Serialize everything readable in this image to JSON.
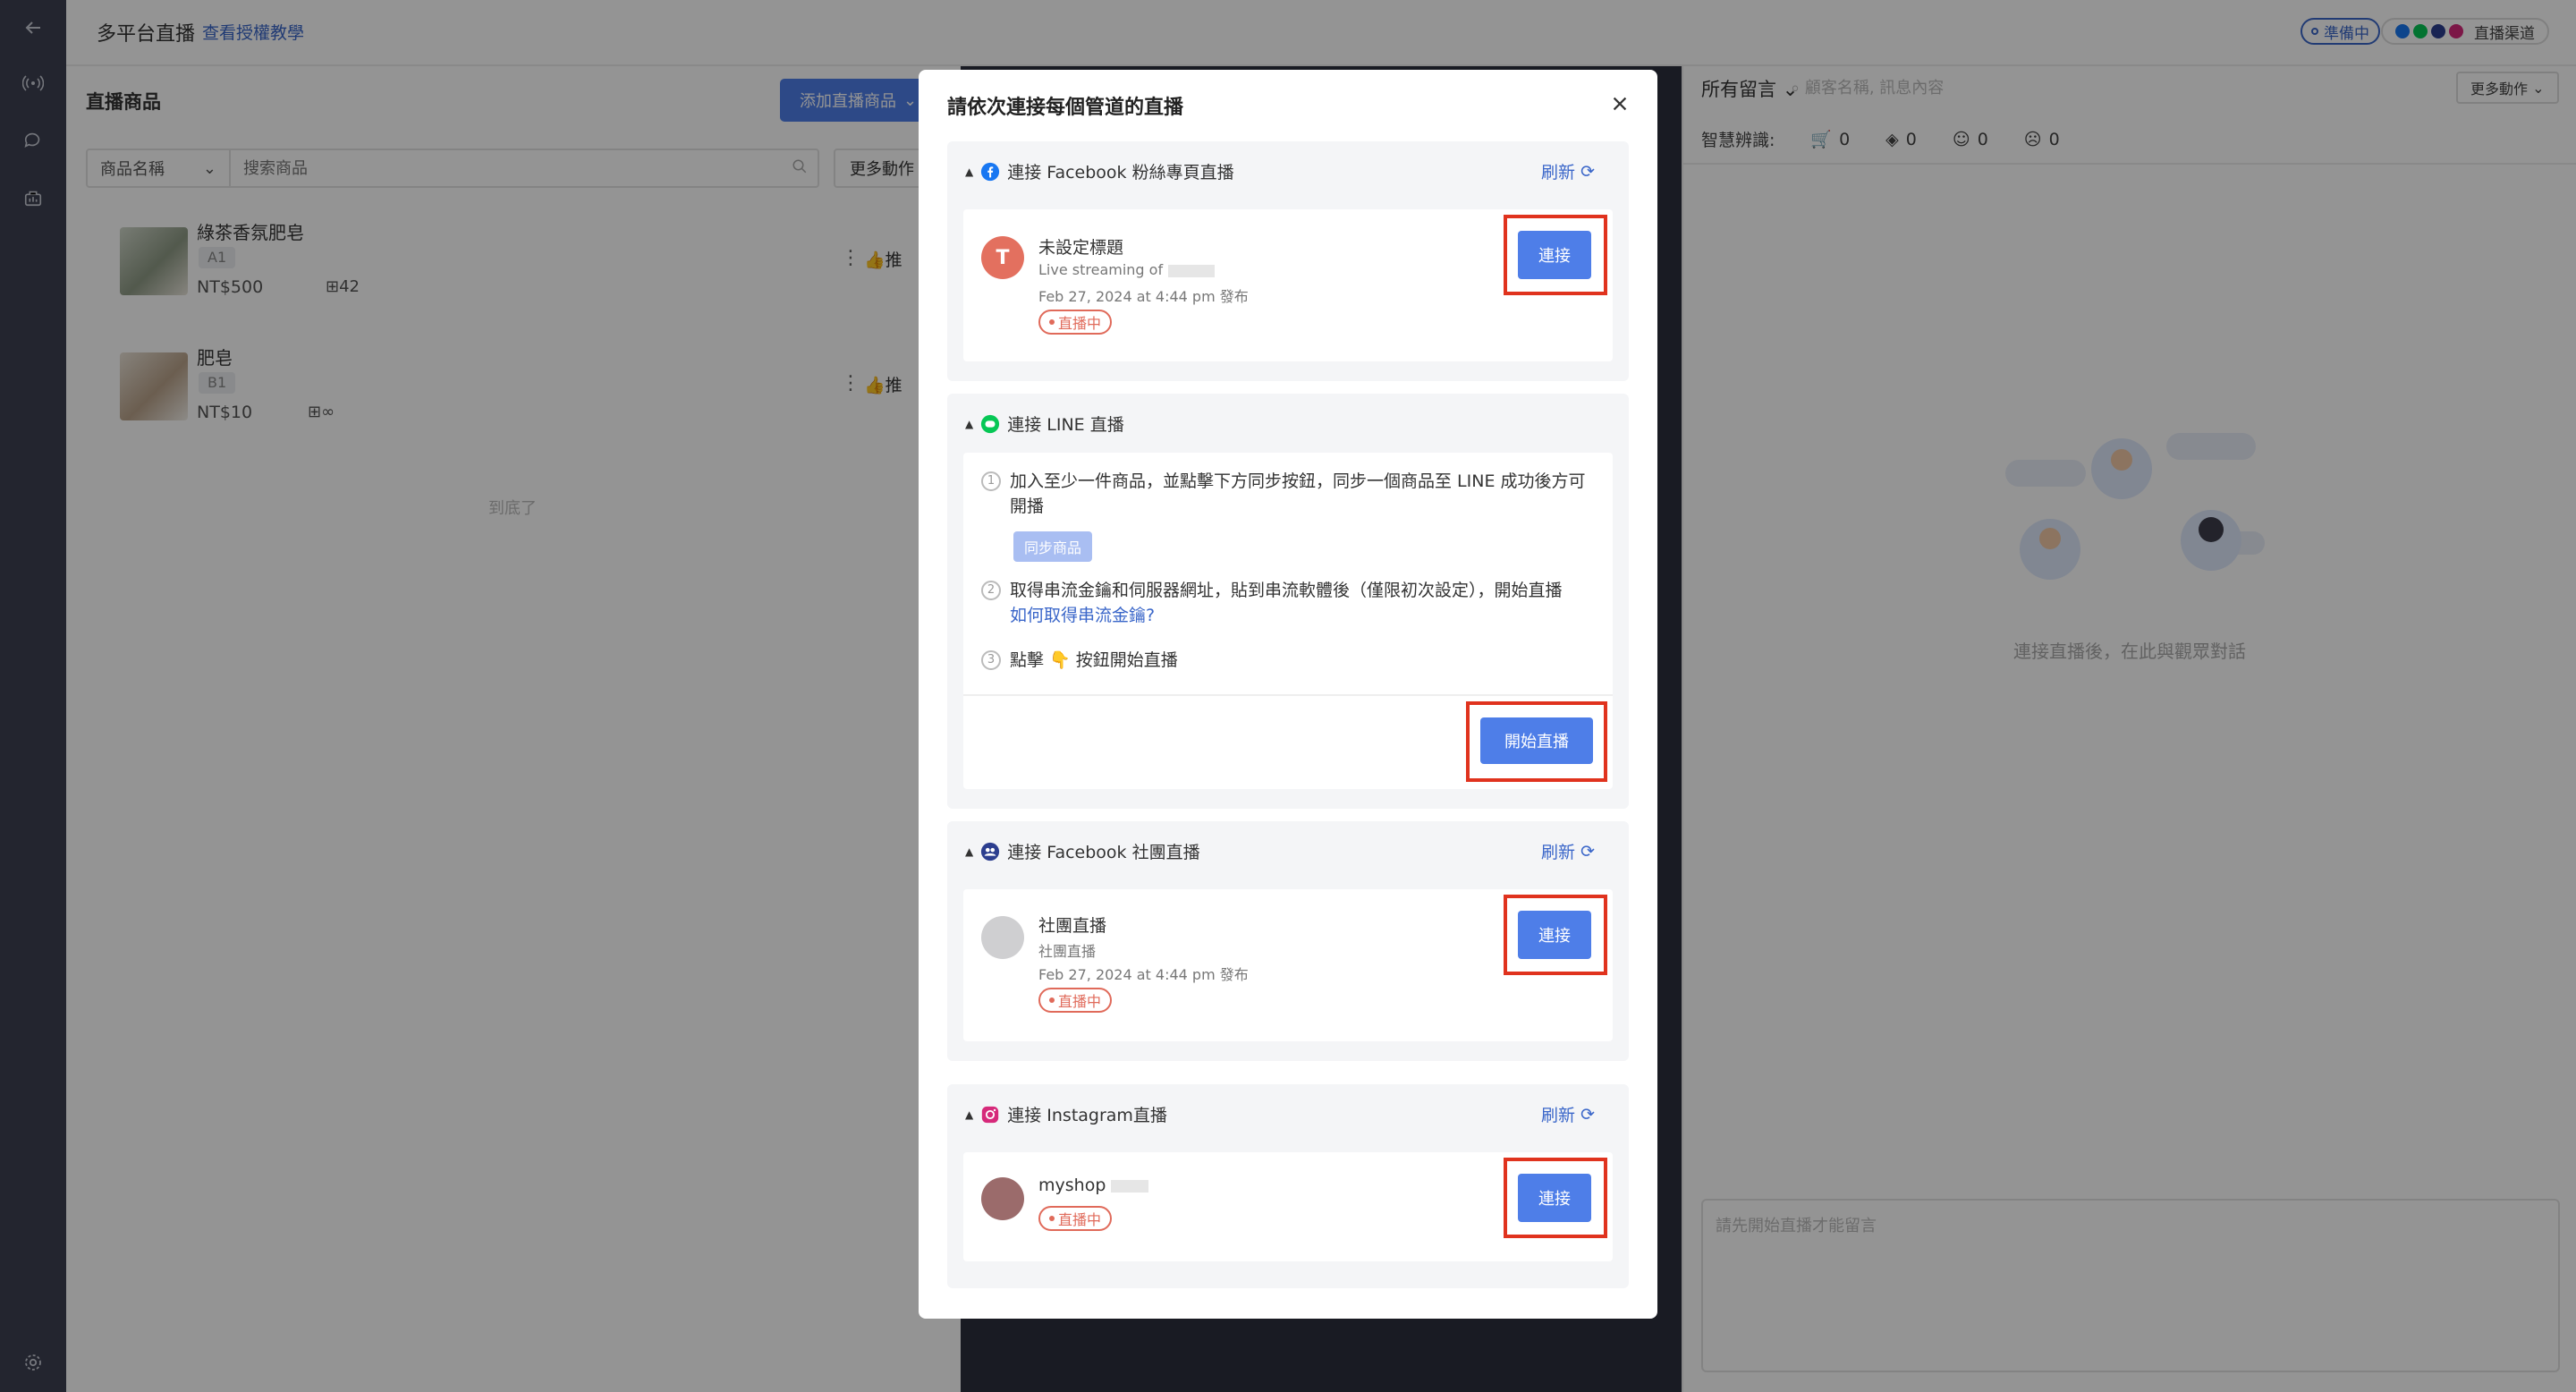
{
  "app": {
    "title": "多平台直播",
    "tutorial_link": "查看授權教學",
    "status_badge": "準備中",
    "channels_label": "直播渠道"
  },
  "left_panel": {
    "heading": "直播商品",
    "add_button": "添加直播商品",
    "filter_select": "商品名稱",
    "search_placeholder": "搜索商品",
    "more_actions": "更多動作",
    "products": [
      {
        "name": "綠茶香氛肥皂",
        "tag": "A1",
        "price": "NT$500",
        "stock": "42",
        "push": "推"
      },
      {
        "name": "肥皂",
        "tag": "B1",
        "price": "NT$10",
        "stock": "∞",
        "push": "推"
      }
    ],
    "end_text": "到底了"
  },
  "right_panel": {
    "comments_filter": "所有留言",
    "search_placeholder": "顧客名稱, 訊息內容",
    "more_actions": "更多動作",
    "smart_label": "智慧辨識:",
    "counts": [
      "0",
      "0",
      "0",
      "0"
    ],
    "empty_text": "連接直播後，在此與觀眾對話",
    "compose_placeholder": "請先開始直播才能留言"
  },
  "modal": {
    "title": "請依次連接每個管道的直播",
    "refresh_label": "刷新",
    "facebook_page": {
      "header": "連接 Facebook 粉絲專頁直播",
      "avatar_letter": "T",
      "name": "未設定標題",
      "sub": "Live streaming of",
      "date": "Feb 27, 2024 at 4:44 pm 發布",
      "status": "直播中",
      "button": "連接"
    },
    "line": {
      "header": "連接 LINE 直播",
      "step1": "加入至少一件商品，並點擊下方同步按鈕，同步一個商品至 LINE 成功後方可開播",
      "sync_button": "同步商品",
      "step2": "取得串流金鑰和伺服器網址，貼到串流軟體後（僅限初次設定），開始直播",
      "step2_link": "如何取得串流金鑰?",
      "step3": "點擊 👇 按鈕開始直播",
      "start_button": "開始直播",
      "step_numbers": [
        "1",
        "2",
        "3"
      ]
    },
    "facebook_group": {
      "header": "連接 Facebook 社團直播",
      "name": "社團直播",
      "sub": "社團直播",
      "date": "Feb 27, 2024 at 4:44 pm 發布",
      "status": "直播中",
      "button": "連接"
    },
    "instagram": {
      "header": "連接 Instagram直播",
      "name": "myshop",
      "status": "直播中",
      "button": "連接"
    }
  },
  "colors": {
    "accent": "#4e7ee8",
    "highlight": "#e0331e",
    "live": "#e06a5a",
    "facebook": "#1877f2",
    "line": "#06c755",
    "instagram": "#d6297a",
    "rail": "#3d4152"
  }
}
